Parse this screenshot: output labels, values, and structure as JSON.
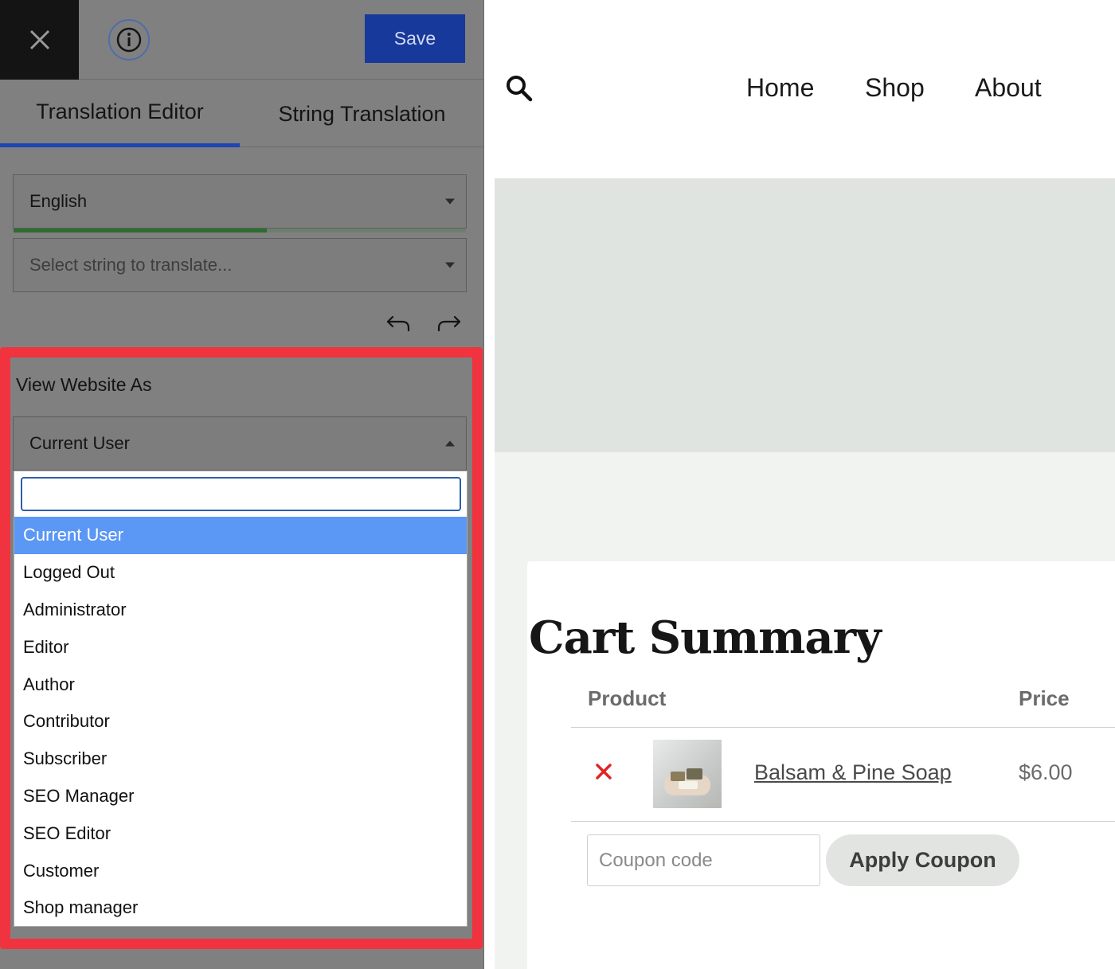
{
  "editor": {
    "save_label": "Save",
    "tabs": [
      {
        "label": "Translation Editor",
        "active": true
      },
      {
        "label": "String Translation",
        "active": false
      }
    ],
    "language_select": {
      "value": "English",
      "translation_progress": 0.56
    },
    "string_select": {
      "placeholder": "Select string to translate..."
    },
    "view_as": {
      "label": "View Website As",
      "selected": "Current User",
      "search_value": "",
      "options": [
        "Current User",
        "Logged Out",
        "Administrator",
        "Editor",
        "Author",
        "Contributor",
        "Subscriber",
        "SEO Manager",
        "SEO Editor",
        "Customer",
        "Shop manager"
      ],
      "highlight_color": "#f0333f"
    },
    "icons": {
      "close": "close-icon",
      "info": "info-icon",
      "undo": "undo-icon",
      "redo": "redo-icon"
    },
    "colors": {
      "panel_bg": "#808080",
      "save_bg": "#17399b",
      "tab_accent": "#1f45b5",
      "selected_option": "#5b97f5",
      "progress": "#2b6e2e"
    }
  },
  "site": {
    "nav": [
      "Home",
      "Shop",
      "About"
    ],
    "cart": {
      "title": "Cart Summary",
      "columns": {
        "product": "Product",
        "price": "Price"
      },
      "items": [
        {
          "name": "Balsam & Pine Soap",
          "price": "$6.00"
        }
      ],
      "coupon_placeholder": "Coupon code",
      "apply_label": "Apply Coupon"
    },
    "colors": {
      "hero_bg": "#e0e4e1",
      "content_bg": "#f1f3f1",
      "remove_x": "#e02424"
    }
  }
}
